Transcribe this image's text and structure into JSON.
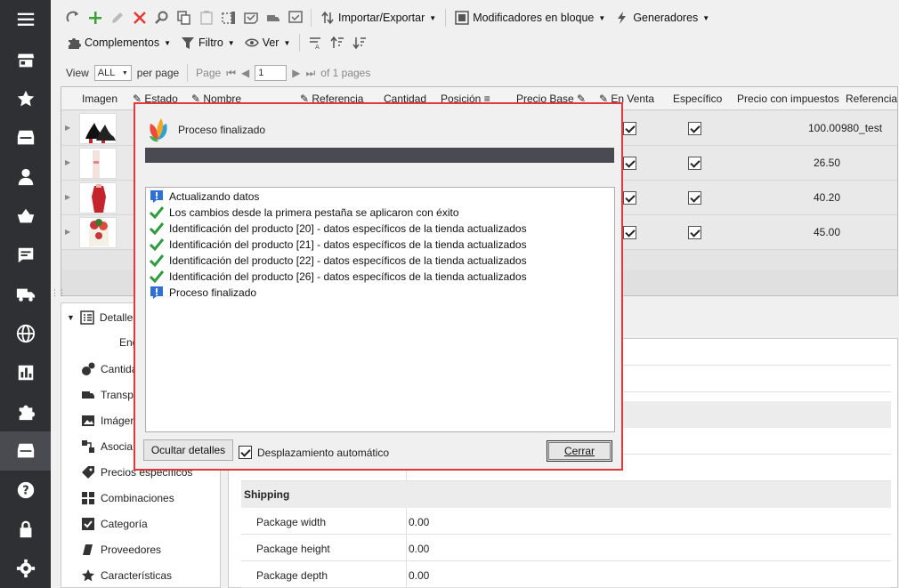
{
  "sidebar": {
    "items": [
      {
        "icon": "menu-icon"
      },
      {
        "icon": "store-icon"
      },
      {
        "icon": "star-icon"
      },
      {
        "icon": "inbox-icon"
      },
      {
        "icon": "user-icon"
      },
      {
        "icon": "basket-icon"
      },
      {
        "icon": "message-icon"
      },
      {
        "icon": "truck-icon"
      },
      {
        "icon": "globe-icon"
      },
      {
        "icon": "stats-icon"
      },
      {
        "icon": "puzzle-icon"
      },
      {
        "icon": "inbox-active-icon"
      },
      {
        "icon": "help-icon"
      },
      {
        "icon": "lock-icon"
      },
      {
        "icon": "gear-icon"
      }
    ]
  },
  "toolbar": {
    "import_export": "Importar/Exportar",
    "bulk_modifiers": "Modificadores en bloque",
    "generators": "Generadores",
    "addons": "Complementos",
    "filter": "Filtro",
    "view": "Ver"
  },
  "pager": {
    "view_label": "View",
    "view_value": "ALL",
    "per_page": "per page",
    "page_label": "Page",
    "page_value": "1",
    "of_pages": "of 1 pages"
  },
  "grid": {
    "headers": {
      "imagen": "Imagen",
      "estado": "Estado",
      "nombre": "Nombre",
      "referencia": "Referencia",
      "cantidad": "Cantidad",
      "posicion": "Posición",
      "precio_base": "Precio Base",
      "en_venta": "En Venta",
      "especifico": "Específico",
      "precio_impuestos": "Precio con impuestos",
      "referencia2": "Referencia"
    },
    "rows": [
      {
        "price": "100.00",
        "ref": "980_test"
      },
      {
        "price": "26.50",
        "ref": ""
      },
      {
        "price": "40.20",
        "ref": ""
      },
      {
        "price": "45.00",
        "ref": ""
      }
    ]
  },
  "tree": {
    "root": "Detalles",
    "child": "Eng",
    "items": [
      "Cantidad",
      "Transp",
      "Imágen",
      "Asocia",
      "Precios específicos",
      "Combinaciones",
      "Categoría",
      "Proveedores",
      "Características"
    ]
  },
  "props": {
    "section": "Shipping",
    "rows": [
      {
        "label": "Package width",
        "value": "0.00"
      },
      {
        "label": "Package height",
        "value": "0.00"
      },
      {
        "label": "Package depth",
        "value": "0.00"
      }
    ]
  },
  "dialog": {
    "title": "Proceso finalizado",
    "log": [
      {
        "type": "info",
        "text": "Actualizando datos"
      },
      {
        "type": "ok",
        "text": "Los cambios desde la primera pestaña se aplicaron con éxito"
      },
      {
        "type": "ok",
        "text": "Identificación del producto [20] - datos específicos de la tienda actualizados"
      },
      {
        "type": "ok",
        "text": "Identificación del producto [21] - datos específicos de la tienda actualizados"
      },
      {
        "type": "ok",
        "text": "Identificación del producto [22] - datos específicos de la tienda actualizados"
      },
      {
        "type": "ok",
        "text": "Identificación del producto [26] - datos específicos de la tienda actualizados"
      },
      {
        "type": "info",
        "text": "Proceso finalizado"
      }
    ],
    "hide_details": "Ocultar detalles",
    "auto_scroll": "Desplazamiento automático",
    "close": "Cerrar",
    "accent_color": "#e5383b"
  }
}
